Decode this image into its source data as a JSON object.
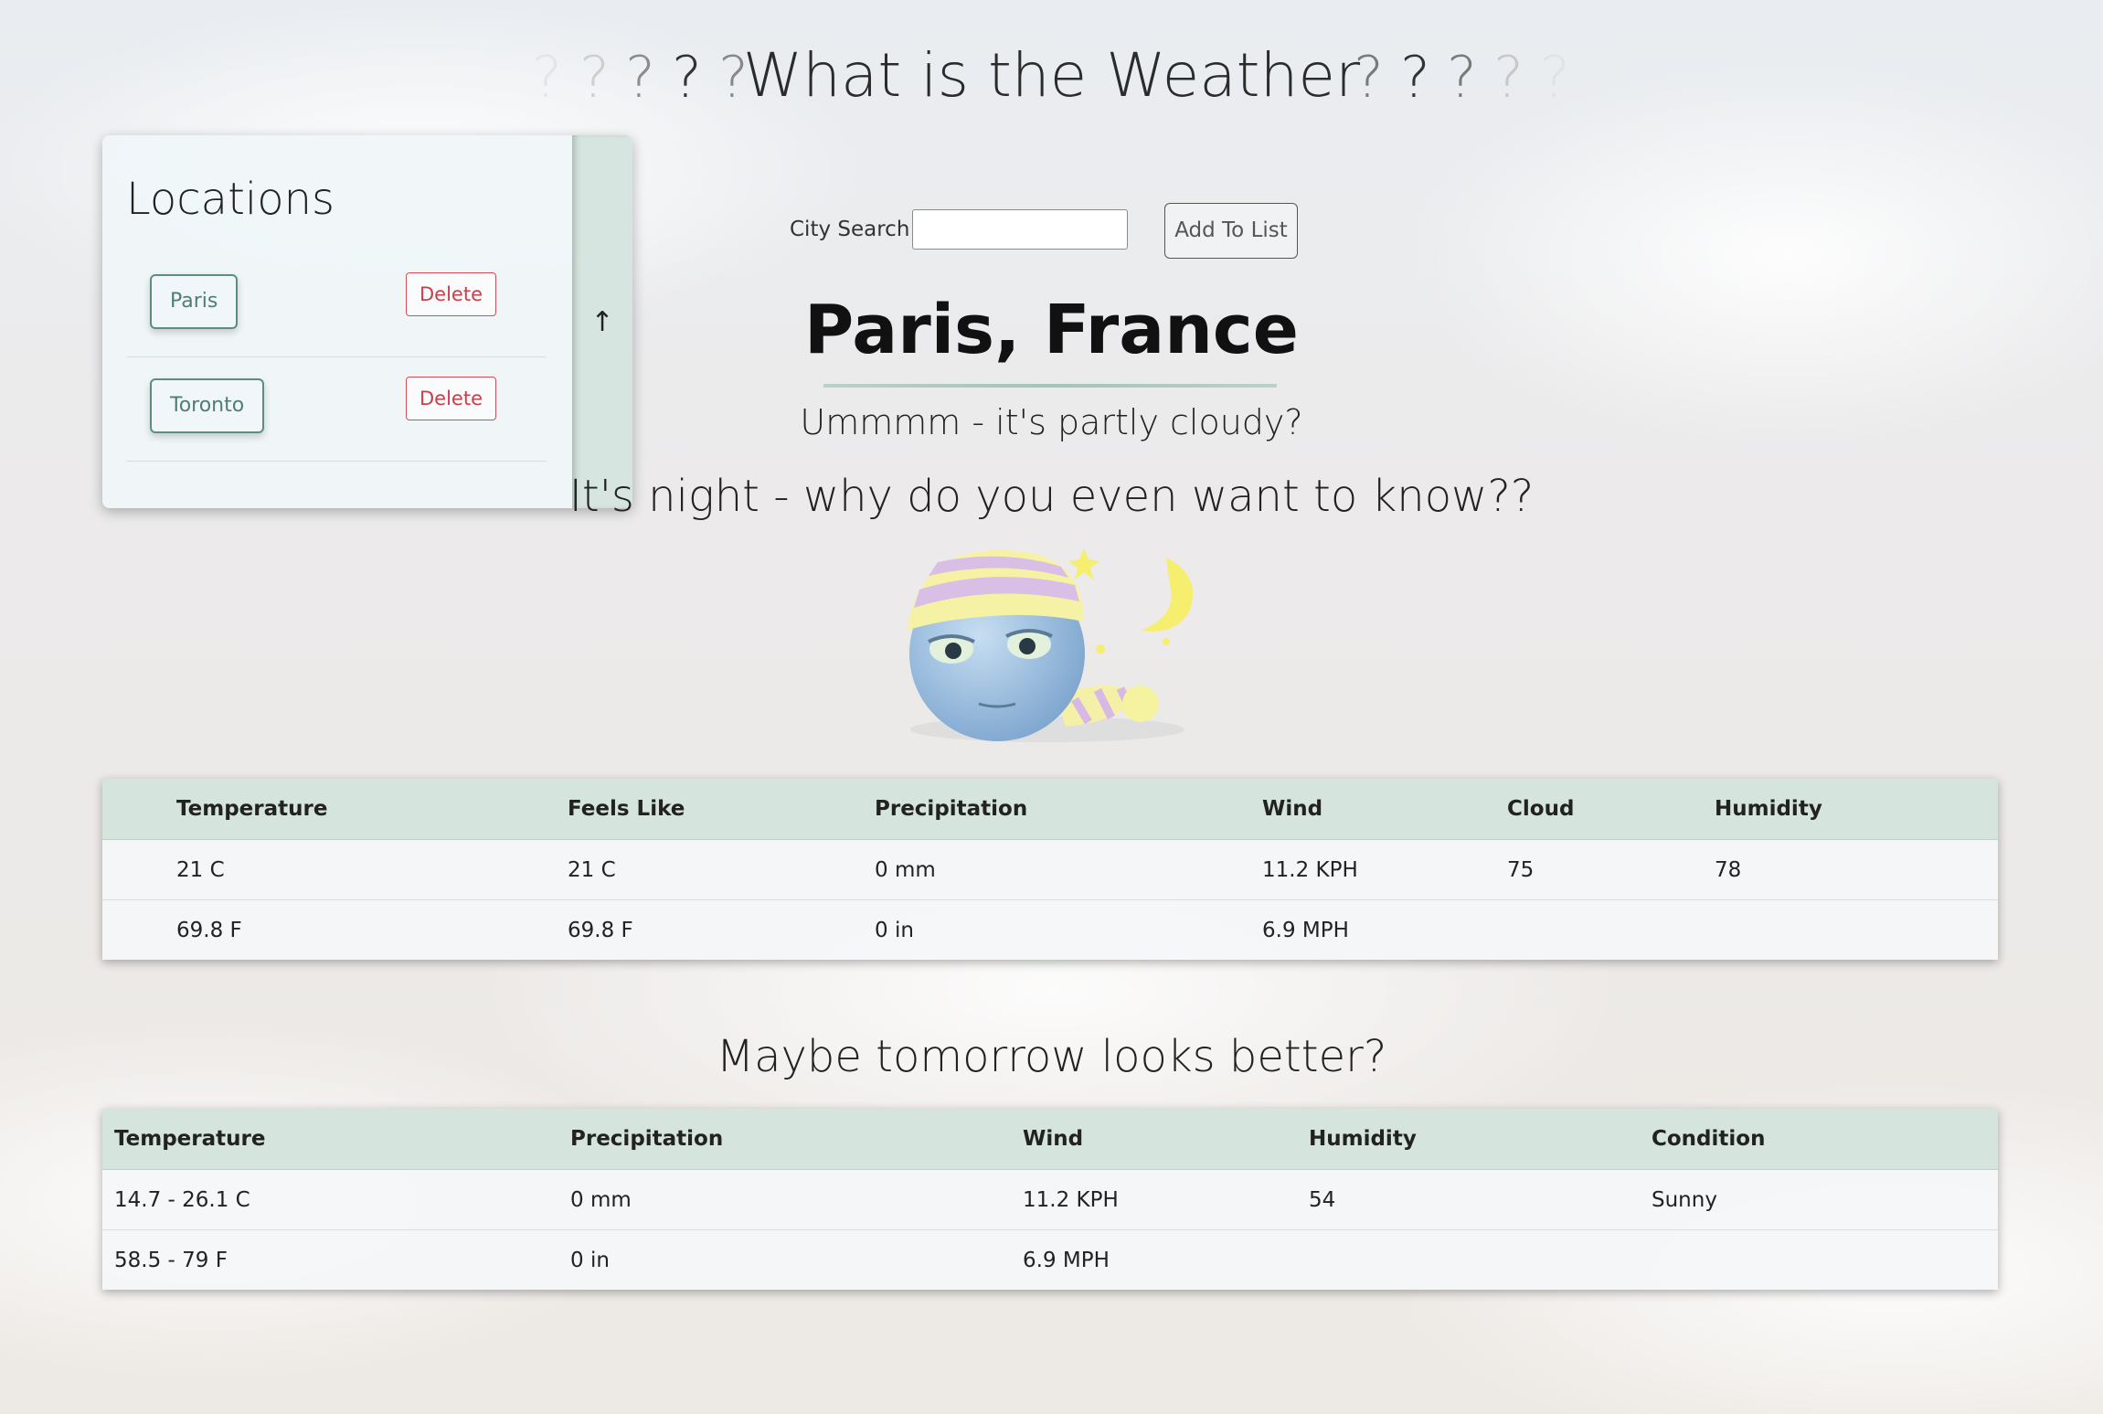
{
  "header": {
    "title": "What is the Weather",
    "question_mark": "?"
  },
  "locations": {
    "title": "Locations",
    "items": [
      {
        "city": "Paris",
        "delete_label": "Delete"
      },
      {
        "city": "Toronto",
        "delete_label": "Delete"
      }
    ],
    "toggle_icon": "↑"
  },
  "search": {
    "label": "City Search",
    "value": "",
    "placeholder": "",
    "add_label": "Add To List"
  },
  "current": {
    "city": "Paris, France",
    "condition": "Ummmm - it's partly cloudy?",
    "night_message": "It's night - why do you even want to know??",
    "icon": "sleepy-night-emoji-icon",
    "table": {
      "headers": [
        "Temperature",
        "Feels Like",
        "Precipitation",
        "Wind",
        "Cloud",
        "Humidity"
      ],
      "rows": [
        [
          "21 C",
          "21 C",
          "0 mm",
          "11.2 KPH",
          "75",
          "78"
        ],
        [
          "69.8 F",
          "69.8 F",
          "0 in",
          "6.9 MPH",
          "",
          ""
        ]
      ]
    }
  },
  "tomorrow": {
    "title": "Maybe tomorrow looks better?",
    "table": {
      "headers": [
        "Temperature",
        "Precipitation",
        "Wind",
        "Humidity",
        "Condition"
      ],
      "rows": [
        [
          "14.7 - 26.1 C",
          "0 mm",
          "11.2 KPH",
          "54",
          "Sunny"
        ],
        [
          "58.5 - 79 F",
          "0 in",
          "6.9 MPH",
          "",
          ""
        ]
      ]
    }
  },
  "colors": {
    "accent_green": "#5c8d7f",
    "table_header_bg": "#d5e4dd",
    "delete_red": "#c9404a"
  }
}
